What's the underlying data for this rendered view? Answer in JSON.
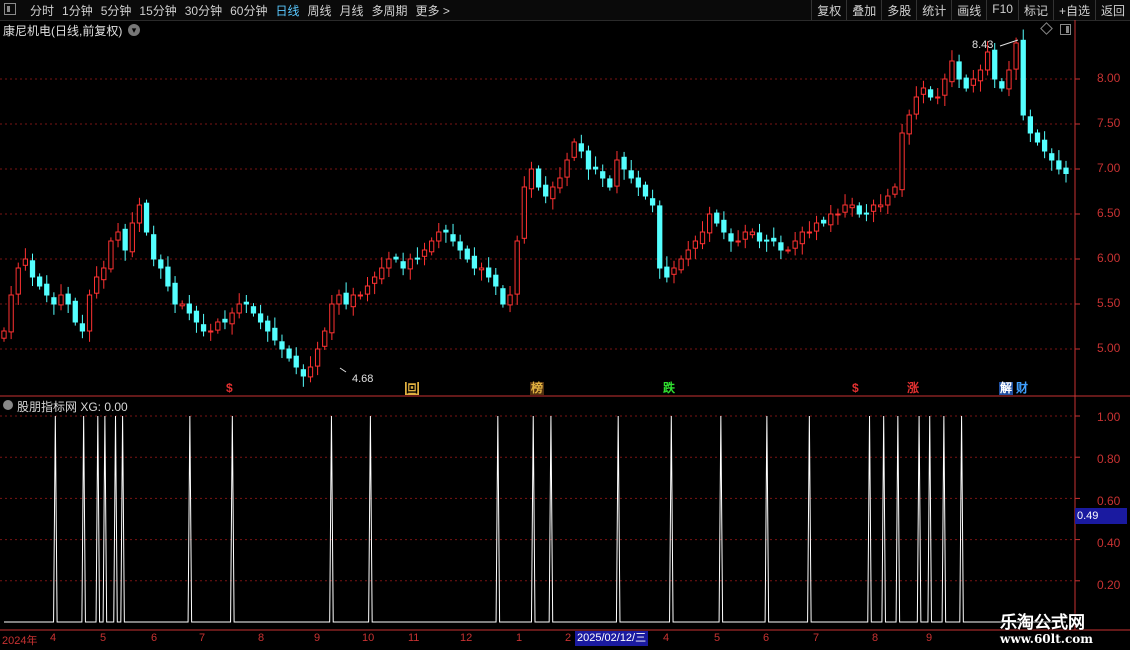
{
  "toolbar": {
    "periods": [
      "分时",
      "1分钟",
      "5分钟",
      "15分钟",
      "30分钟",
      "60分钟",
      "日线",
      "周线",
      "月线",
      "多周期",
      "更多 >"
    ],
    "active_period": "日线",
    "right_buttons": [
      "复权",
      "叠加",
      "多股",
      "统计",
      "画线",
      "F10",
      "标记",
      "+自选",
      "返回"
    ]
  },
  "stock": {
    "title": "康尼机电(日线,前复权)"
  },
  "price_axis": {
    "ticks": [
      "8.00",
      "7.50",
      "7.00",
      "6.50",
      "6.00",
      "5.50",
      "5.00"
    ]
  },
  "markers": {
    "high": "8.43",
    "low": "4.68"
  },
  "signals": [
    {
      "label": "$",
      "color": "#e03030",
      "bg": ""
    },
    {
      "label": "回",
      "color": "#000000",
      "bg": "#e0b040"
    },
    {
      "label": "榜",
      "color": "#e0b040",
      "bg": "#503010"
    },
    {
      "label": "跌",
      "color": "#30e030",
      "bg": ""
    },
    {
      "label": "$",
      "color": "#e03030",
      "bg": ""
    },
    {
      "label": "涨",
      "color": "#e03030",
      "bg": ""
    },
    {
      "label": "解",
      "color": "#ffffff",
      "bg": "#2050a0"
    },
    {
      "label": "财",
      "color": "#40a0ff",
      "bg": ""
    }
  ],
  "indicator": {
    "title": "股朋指标网 XG: 0.00",
    "ticks": [
      "1.00",
      "0.80",
      "0.60",
      "0.40",
      "0.20"
    ],
    "current_value": "0.49"
  },
  "date_axis": {
    "labels": [
      "2024年",
      "4",
      "5",
      "6",
      "7",
      "8",
      "9",
      "10",
      "11",
      "12",
      "1",
      "2",
      "4",
      "5",
      "6",
      "7",
      "8",
      "9"
    ],
    "selected": "2025/02/12/三"
  },
  "watermark": {
    "line1": "乐淘公式网",
    "line2": "www.60lt.com"
  },
  "colors": {
    "up": "#ff3232",
    "down": "#54ffff",
    "grid": "#7a1414",
    "axis": "#c83232",
    "indicator_line": "#ffffff"
  },
  "chart_data": [
    {
      "type": "candlestick",
      "title": "康尼机电(日线,前复权)",
      "ylim": [
        4.5,
        8.6
      ],
      "y_ticks": [
        5.0,
        5.5,
        6.0,
        6.5,
        7.0,
        7.5,
        8.0
      ],
      "close_trend": [
        5.2,
        5.6,
        5.9,
        6.0,
        5.8,
        5.7,
        5.6,
        5.5,
        5.6,
        5.5,
        5.3,
        5.2,
        5.6,
        5.8,
        5.9,
        6.2,
        6.3,
        6.1,
        6.4,
        6.6,
        6.3,
        6.0,
        5.9,
        5.7,
        5.5,
        5.5,
        5.4,
        5.3,
        5.2,
        5.2,
        5.3,
        5.3,
        5.4,
        5.5,
        5.5,
        5.4,
        5.3,
        5.2,
        5.1,
        5.0,
        4.9,
        4.8,
        4.7,
        4.8,
        5.0,
        5.2,
        5.5,
        5.6,
        5.5,
        5.6,
        5.6,
        5.7,
        5.8,
        5.9,
        6.0,
        6.0,
        5.9,
        6.0,
        6.0,
        6.1,
        6.2,
        6.3,
        6.3,
        6.2,
        6.1,
        6.0,
        5.9,
        5.9,
        5.8,
        5.7,
        5.5,
        5.6,
        6.2,
        6.8,
        7.0,
        6.8,
        6.7,
        6.8,
        6.9,
        7.1,
        7.3,
        7.2,
        7.0,
        7.0,
        6.9,
        6.8,
        7.1,
        7.0,
        6.9,
        6.8,
        6.7,
        6.6,
        5.9,
        5.8,
        5.9,
        6.0,
        6.1,
        6.2,
        6.3,
        6.5,
        6.4,
        6.3,
        6.2,
        6.2,
        6.3,
        6.3,
        6.2,
        6.2,
        6.2,
        6.1,
        6.1,
        6.2,
        6.3,
        6.3,
        6.4,
        6.4,
        6.5,
        6.5,
        6.6,
        6.6,
        6.5,
        6.5,
        6.6,
        6.6,
        6.7,
        6.8,
        7.4,
        7.6,
        7.8,
        7.9,
        7.8,
        7.8,
        8.0,
        8.2,
        8.0,
        7.9,
        8.0,
        8.1,
        8.3,
        8.0,
        7.9,
        8.1,
        8.4,
        7.6,
        7.4,
        7.3,
        7.2,
        7.1,
        7.0,
        6.95
      ],
      "high_marker": 8.43,
      "low_marker": 4.68
    },
    {
      "type": "line",
      "title": "股朋指标网 XG: 0.00",
      "ylim": [
        0,
        1.1
      ],
      "y_ticks": [
        0.2,
        0.4,
        0.6,
        0.8,
        1.0
      ],
      "spike_positions": [
        14,
        22,
        26,
        28,
        31,
        33,
        52,
        64,
        92,
        103,
        139,
        149,
        154,
        173,
        188,
        202,
        215,
        227,
        244,
        248,
        252,
        258,
        261,
        265,
        270
      ],
      "baseline": 0.0,
      "spike_value": 1.0,
      "current_value": 0.49
    }
  ]
}
